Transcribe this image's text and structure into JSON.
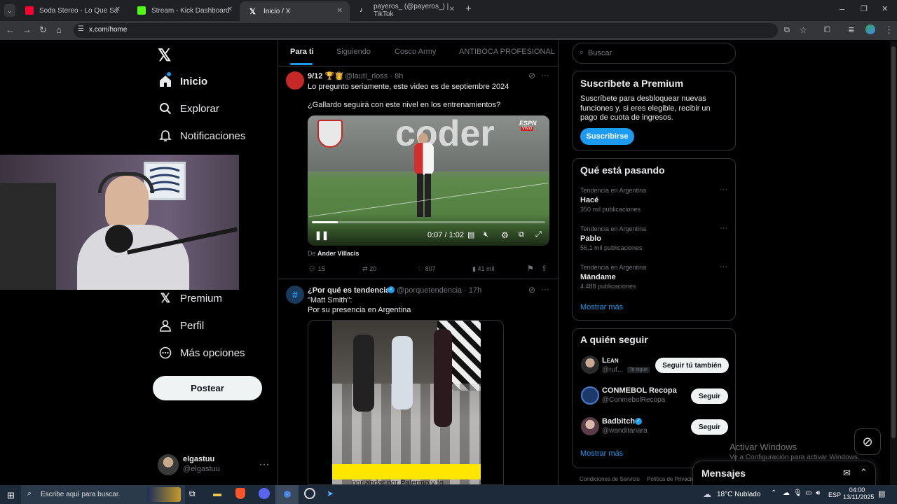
{
  "browser": {
    "tabs": [
      {
        "label": "Soda Stereo - Lo Que Sangra (I",
        "color": "#ff0033"
      },
      {
        "label": "Stream - Kick Dashboard",
        "color": "#53fc18"
      },
      {
        "label": "Inicio / X",
        "color": "#ffffff"
      },
      {
        "label": "payeros_ (@payeros_) | TikTok",
        "color": "#ffffff"
      }
    ],
    "url": "x.com/home"
  },
  "nav": {
    "items": [
      {
        "label": "Inicio"
      },
      {
        "label": "Explorar"
      },
      {
        "label": "Notificaciones"
      },
      {
        "label": "Premium"
      },
      {
        "label": "Perfil"
      },
      {
        "label": "Más opciones"
      }
    ],
    "post_button": "Postear",
    "account": {
      "name": "elgastuu",
      "handle": "@elgastuu"
    }
  },
  "feed": {
    "tabs": [
      "Para ti",
      "Siguiendo",
      "Cosco Army",
      "ANTIBOCA PROFESIONAL"
    ],
    "tweet1": {
      "name": "9/12 🏆👸",
      "handle": "@lautI_rloss · 8h",
      "text1": "Lo pregunto seriamente, este video es de septiembre 2024",
      "text2": "¿Gallardo seguirá con este nivel en los entrenamientos?",
      "video_time": "0:07 / 1:02",
      "video_progress": 0.11,
      "video_brand": "ESPN",
      "video_live": "VIVO",
      "video_sign": "coder",
      "from_label": "De",
      "from_user": "Ander Villacis",
      "replies": "15",
      "retweets": "20",
      "likes": "807",
      "views": "41 mil"
    },
    "tweet2": {
      "name": "¿Por qué es tendencia?",
      "handle": "@porquetendencia · 17h",
      "text1": "\"Matt Smith\":",
      "text2": "Por su presencia en Argentina",
      "caption": "por andar por Palermo y fo"
    }
  },
  "sidebar": {
    "search_placeholder": "Buscar",
    "premium": {
      "title": "Suscríbete a Premium",
      "body": "Suscríbete para desbloquear nuevas funciones y, si eres elegible, recibir un pago de cuota de ingresos.",
      "button": "Suscribirse"
    },
    "trends": {
      "title": "Qué está pasando",
      "items": [
        {
          "category": "Tendencia en Argentina",
          "name": "Hacé",
          "count": "350 mil publicaciones"
        },
        {
          "category": "Tendencia en Argentina",
          "name": "Pablo",
          "count": "56,1 mil publicaciones"
        },
        {
          "category": "Tendencia en Argentina",
          "name": "Mándame",
          "count": "4.488 publicaciones"
        }
      ],
      "more": "Mostrar más"
    },
    "follow": {
      "title": "A quién seguir",
      "items": [
        {
          "name": "Lean",
          "handle": "@ruf...",
          "badge": "Te sigue",
          "button": "Seguir tú también"
        },
        {
          "name": "CONMEBOL Recopa",
          "handle": "@ConmebolRecopa",
          "button": "Seguir"
        },
        {
          "name": "Badbitch",
          "handle": "@wanditanara",
          "button": "Seguir"
        }
      ],
      "more": "Mostrar más"
    },
    "footer": [
      "Condiciones de Servicio",
      "Política de Privacidad"
    ]
  },
  "messages": {
    "label": "Mensajes"
  },
  "watermark": {
    "line1": "Activar Windows",
    "line2": "Ve a Configuración para activar Windows."
  },
  "taskbar": {
    "search": "Escribe aquí para buscar.",
    "weather": "18°C  Nublado",
    "lang": "ESP",
    "time": "04:00",
    "date": "13/11/2025"
  }
}
